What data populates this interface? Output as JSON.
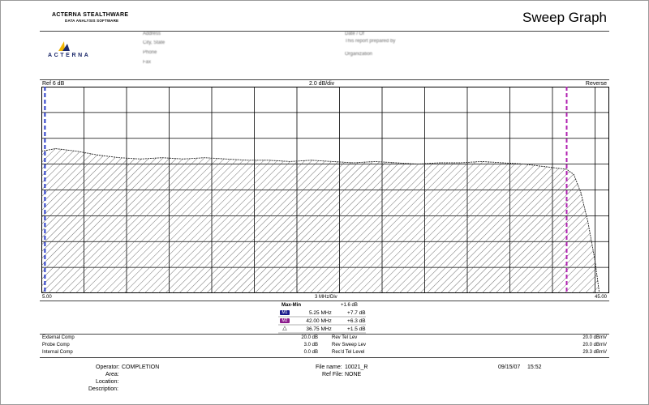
{
  "header": {
    "brand_line1": "ACTERNA STEALTHWARE",
    "brand_line2": "DATA ANALYSIS SOFTWARE",
    "logo_word": "ACTERNA",
    "title": "Sweep Graph",
    "info_left": [
      "Address",
      "City, State",
      "Phone",
      "Fax"
    ],
    "info_right": [
      "Date / Of",
      "This report prepared by",
      "Organization"
    ]
  },
  "graph": {
    "ref_label": "Ref 6 dB",
    "scale_label": "2.0 dB/div",
    "mode_label": "Reverse",
    "start_label": "5.00",
    "x_div_label": "3 MHz/Div",
    "end_label": "45.00"
  },
  "markers": {
    "header": "Max-Min",
    "max_min_value": "+1.6 dB",
    "rows": [
      {
        "badge": "M1",
        "freq": "5.25 MHz",
        "level": "+7.7 dB",
        "color": "#1a1a8c"
      },
      {
        "badge": "M2",
        "freq": "42.00 MHz",
        "level": "+6.3 dB",
        "color": "#8c1a8c"
      },
      {
        "badge": "△",
        "freq": "36.75 MHz",
        "level": "+1.5 dB",
        "color": "#000000"
      }
    ]
  },
  "comp": [
    {
      "label": "External Comp",
      "value": "20.0 dB",
      "label2": "Rev Tel Lev",
      "value2": "20.0 dBmV"
    },
    {
      "label": "Probe Comp",
      "value": "3.0 dB",
      "label2": "Rev Sweep Lev",
      "value2": "20.0 dBmV"
    },
    {
      "label": "Internal Comp",
      "value": "0.0 dB",
      "label2": "Rec'd Tel Level",
      "value2": "29.3 dBmV"
    }
  ],
  "footer": {
    "operator_label": "Operator:",
    "operator_value": "COMPLETION",
    "area_label": "Area:",
    "location_label": "Location:",
    "description_label": "Description:",
    "file_name_label": "File name:",
    "file_name_value": "10021_R",
    "ref_file_label": "Ref File:",
    "ref_file_value": "NONE",
    "date": "09/15/07",
    "time": "15:52"
  },
  "chart_data": {
    "type": "area",
    "xlabel": "3 MHz/Div",
    "ylabel": "2.0 dB/div",
    "xlim": [
      5.0,
      45.0
    ],
    "ylim": [
      -10,
      6
    ],
    "grid": true,
    "x": [
      5.0,
      6.0,
      7.5,
      9.0,
      10.5,
      12.0,
      13.5,
      15.0,
      16.5,
      18.0,
      19.5,
      21.0,
      22.5,
      24.0,
      25.5,
      27.0,
      28.5,
      30.0,
      31.5,
      33.0,
      34.5,
      36.0,
      37.5,
      39.0,
      40.5,
      42.0,
      42.5,
      43.0,
      43.5,
      44.0,
      44.3
    ],
    "series": [
      {
        "values": [
          1.0,
          1.2,
          1.0,
          0.7,
          0.5,
          0.4,
          0.5,
          0.4,
          0.5,
          0.4,
          0.3,
          0.3,
          0.2,
          0.3,
          0.2,
          0.1,
          0.2,
          0.1,
          0.0,
          0.1,
          0.1,
          0.2,
          0.1,
          0.0,
          -0.2,
          -0.4,
          -0.8,
          -2.2,
          -4.5,
          -7.5,
          -10.0
        ]
      }
    ],
    "markers": [
      {
        "x": 5.25,
        "color": "#2a3cc8"
      },
      {
        "x": 42.0,
        "color": "#b020b0"
      }
    ]
  }
}
